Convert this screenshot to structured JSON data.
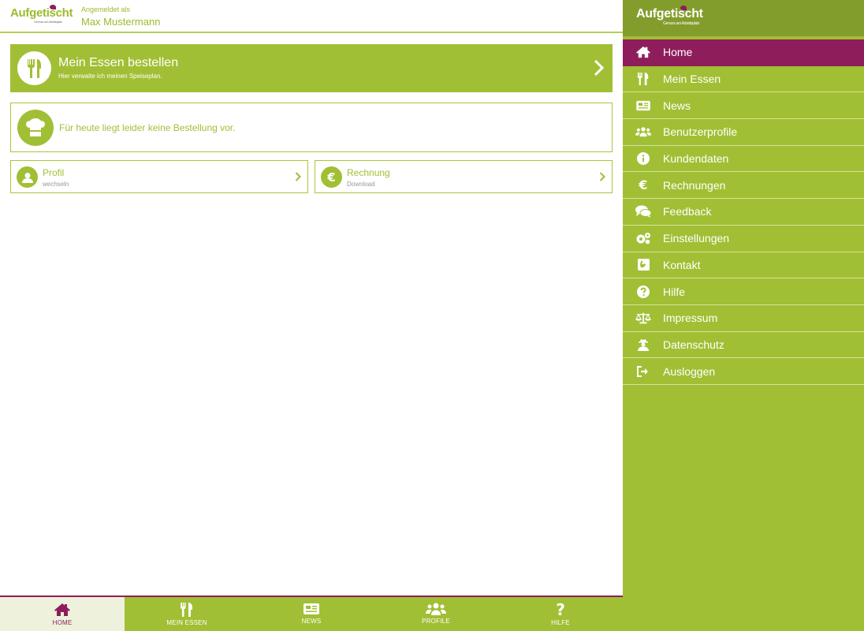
{
  "brand": {
    "name": "Aufgetischt",
    "tagline": "Genuss am Arbeitsplatz",
    "colors": {
      "green": "#a1bf34",
      "dark_green": "#829d2c",
      "magenta": "#8e1e5b"
    }
  },
  "header": {
    "login_label": "Angemeldet als",
    "user_name": "Max Mustermann"
  },
  "order_card": {
    "title": "Mein Essen bestellen",
    "subtitle": "Hier verwalte ich meinen Speiseplan.",
    "icon": "cutlery-icon"
  },
  "today_card": {
    "text": "Für heute liegt leider keine Bestellung vor.",
    "icon": "chef-hat-icon"
  },
  "profile_card": {
    "title": "Profil",
    "subtitle": "wechseln",
    "icon": "user-icon"
  },
  "invoice_card": {
    "title": "Rechnung",
    "subtitle": "Download",
    "icon": "euro-icon"
  },
  "bottom_nav": [
    {
      "label": "HOME",
      "icon": "home-icon",
      "active": true
    },
    {
      "label": "MEIN ESSEN",
      "icon": "cutlery-icon",
      "active": false
    },
    {
      "label": "NEWS",
      "icon": "newspaper-icon",
      "active": false
    },
    {
      "label": "PROFILE",
      "icon": "users-icon",
      "active": false
    },
    {
      "label": "HILFE",
      "icon": "question-icon",
      "active": false
    }
  ],
  "sidebar": {
    "items": [
      {
        "label": "Home",
        "icon": "home-icon",
        "active": true
      },
      {
        "label": "Mein Essen",
        "icon": "cutlery-icon"
      },
      {
        "label": "News",
        "icon": "newspaper-icon"
      },
      {
        "label": "Benutzerprofile",
        "icon": "users-icon"
      },
      {
        "label": "Kundendaten",
        "icon": "info-icon"
      },
      {
        "label": "Rechnungen",
        "icon": "euro-icon"
      },
      {
        "label": "Feedback",
        "icon": "comments-icon"
      },
      {
        "label": "Einstellungen",
        "icon": "gears-icon"
      },
      {
        "label": "Kontakt",
        "icon": "phone-icon"
      },
      {
        "label": "Hilfe",
        "icon": "question-icon"
      },
      {
        "label": "Impressum",
        "icon": "balance-scale-icon"
      },
      {
        "label": "Datenschutz",
        "icon": "user-secret-icon"
      },
      {
        "label": "Ausloggen",
        "icon": "sign-out-icon"
      }
    ]
  }
}
